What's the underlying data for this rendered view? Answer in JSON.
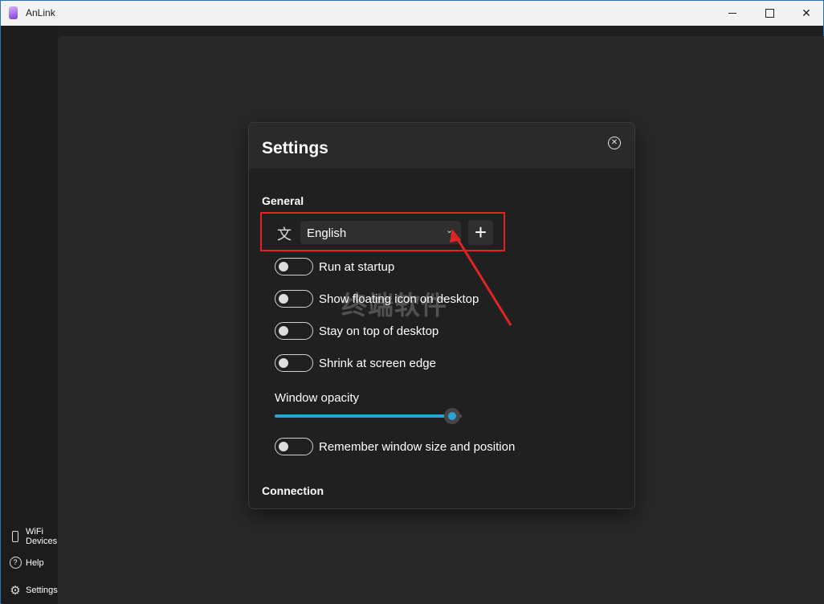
{
  "app": {
    "title": "AnLink"
  },
  "window_controls": {
    "minimize": "minimize-icon",
    "maximize": "maximize-icon",
    "close": "close-icon"
  },
  "nav": {
    "items": [
      {
        "label_line1": "WiFi",
        "label_line2": "Devices",
        "icon": "phone-icon"
      },
      {
        "label": "Help",
        "icon": "help-icon"
      },
      {
        "label": "Settings",
        "icon": "gear-icon"
      }
    ]
  },
  "dialog": {
    "title": "Settings",
    "close_icon": "close-circle-icon",
    "sections": {
      "general": "General",
      "connection": "Connection"
    },
    "language": {
      "icon": "translate-icon",
      "value": "English",
      "add_icon": "plus-icon"
    },
    "toggles": [
      {
        "label": "Run at startup",
        "state": "off"
      },
      {
        "label": "Show floating icon on desktop",
        "state": "off"
      },
      {
        "label": "Stay on top of desktop",
        "state": "off"
      },
      {
        "label": "Shrink at screen edge",
        "state": "off"
      }
    ],
    "opacity": {
      "label": "Window opacity",
      "value": 0.95
    },
    "remember_toggle": {
      "label": "Remember window size and position",
      "state": "off"
    }
  },
  "annotation": {
    "box_color": "#e02424",
    "watermark_text": "终端软件"
  },
  "colors": {
    "accent": "#29a3d6",
    "background": "#282828",
    "dialog": "#202020",
    "highlight": "#e02424"
  }
}
